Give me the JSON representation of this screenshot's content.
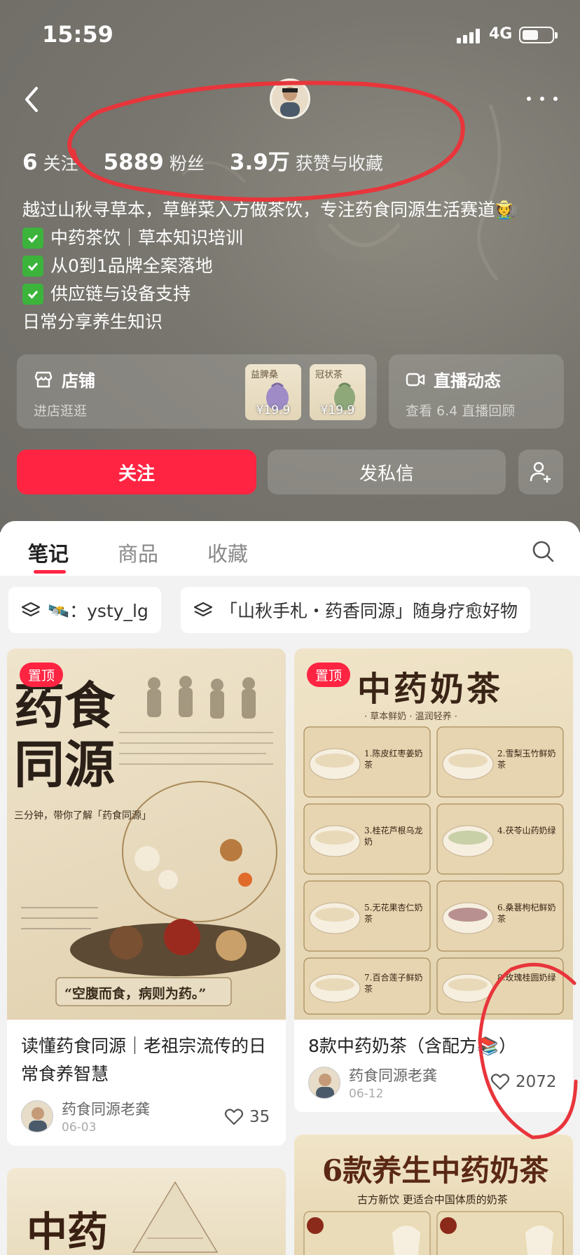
{
  "status_bar": {
    "time": "15:59",
    "network": "4G"
  },
  "stats": [
    {
      "num": "6",
      "label": "关注"
    },
    {
      "num": "5889",
      "label": "粉丝"
    },
    {
      "num": "3.9万",
      "label": "获赞与收藏"
    }
  ],
  "bio": {
    "line1": "越过山秋寻草本，草鲜菜入方做茶饮，专注药食同源生活赛道🧑‍🌾",
    "items": [
      "中药茶饮｜草本知识培训",
      "从0到1品牌全案落地",
      "供应链与设备支持"
    ],
    "line_last": "日常分享养生知识"
  },
  "shop": {
    "title": "店铺",
    "subtitle": "进店逛逛",
    "products": [
      {
        "price": "¥19.9",
        "label": "益脾桑"
      },
      {
        "price": "¥19.9",
        "label": "冠状茶"
      }
    ]
  },
  "live": {
    "title": "直播动态",
    "subtitle": "查看 6.4 直播回顾"
  },
  "actions": {
    "follow": "关注",
    "message": "发私信"
  },
  "tabs": {
    "items": [
      "笔记",
      "商品",
      "收藏"
    ]
  },
  "chips": [
    {
      "text": "🛰️：ysty_lg"
    },
    {
      "text": "「山秋手札・药香同源」随身疗愈好物"
    }
  ],
  "posts": [
    {
      "pin": "置顶",
      "title": "读懂药食同源｜老祖宗流传的日常食养智慧",
      "author": "药食同源老龚",
      "date": "06-03",
      "likes": "35",
      "cover_heading": "药食同源",
      "cover_sub": "三分钟，带你了解「药食同源」",
      "cover_quote": "“空腹而食，病则为药。”"
    },
    {
      "pin": "置顶",
      "title": "8款中药奶茶（含配方📚）",
      "author": "药食同源老龚",
      "date": "06-12",
      "likes": "2072",
      "cover_heading": "中药奶茶",
      "cover_sub": "· 草本鲜奶 · 温润轻养 ·",
      "recipes": [
        "1.陈皮红枣姜奶茶",
        "2.雪梨玉竹鲜奶茶",
        "3.桂花芦根乌龙奶",
        "4.茯苓山药奶绿",
        "5.无花果杏仁奶茶",
        "6.桑葚枸杞鲜奶茶",
        "7.百合莲子鲜奶茶",
        "8.玫瑰桂圆奶绿"
      ]
    },
    {
      "cover_heading": "中药"
    },
    {
      "cover_heading": "6款养生中药奶茶",
      "cover_sub": "古方新饮  更适合中国体质的奶茶"
    }
  ],
  "colors": {
    "accent": "#ff2442",
    "annotation": "#e8353b"
  }
}
